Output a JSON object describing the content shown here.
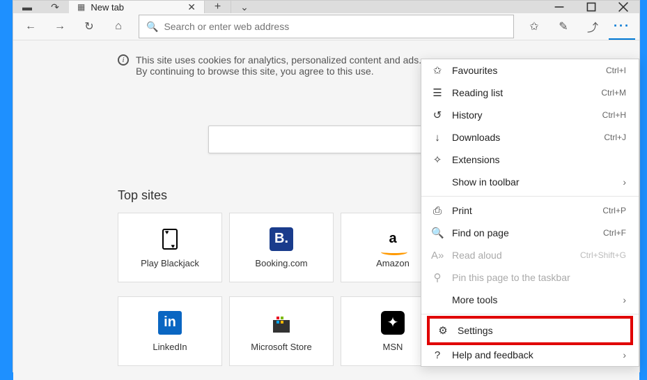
{
  "tab": {
    "label": "New tab"
  },
  "addressbar": {
    "placeholder": "Search or enter web address"
  },
  "cookie_notice": "This site uses cookies for analytics, personalized content and ads. By continuing to browse this site, you agree to this use.",
  "top_sites_heading": "Top sites",
  "tiles": {
    "row1": [
      {
        "label": "Play Blackjack"
      },
      {
        "label": "Booking.com"
      },
      {
        "label": "Amazon"
      }
    ],
    "row2": [
      {
        "label": "LinkedIn"
      },
      {
        "label": "Microsoft Store"
      },
      {
        "label": "MSN"
      }
    ]
  },
  "menu": {
    "favourites": {
      "label": "Favourites",
      "shortcut": "Ctrl+I"
    },
    "readinglist": {
      "label": "Reading list",
      "shortcut": "Ctrl+M"
    },
    "history": {
      "label": "History",
      "shortcut": "Ctrl+H"
    },
    "downloads": {
      "label": "Downloads",
      "shortcut": "Ctrl+J"
    },
    "extensions": {
      "label": "Extensions"
    },
    "showtoolbar": {
      "label": "Show in toolbar"
    },
    "print": {
      "label": "Print",
      "shortcut": "Ctrl+P"
    },
    "find": {
      "label": "Find on page",
      "shortcut": "Ctrl+F"
    },
    "readaloud": {
      "label": "Read aloud",
      "shortcut": "Ctrl+Shift+G"
    },
    "pin": {
      "label": "Pin this page to the taskbar"
    },
    "moretools": {
      "label": "More tools"
    },
    "settings": {
      "label": "Settings"
    },
    "help": {
      "label": "Help and feedback"
    }
  }
}
